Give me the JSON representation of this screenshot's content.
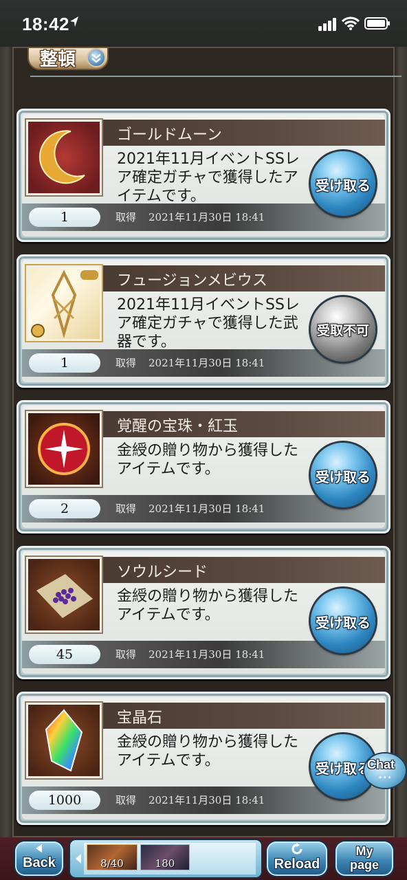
{
  "status_bar": {
    "time": "18:42"
  },
  "toolbar": {
    "sort_label": "整頓"
  },
  "items": [
    {
      "name": "ゴールドムーン",
      "description": "2021年11月イベントSSレア確定ガチャで獲得したアイテムです。",
      "quantity": "1",
      "acquired_label": "取得",
      "date": "2021年11月30日 18:41",
      "button": "受け取る",
      "button_state": "available"
    },
    {
      "name": "フュージョンメビウス",
      "description": "2021年11月イベントSSレア確定ガチャで獲得した武器です。",
      "quantity": "1",
      "acquired_label": "取得",
      "date": "2021年11月30日 18:41",
      "button": "受取不可",
      "button_state": "unavailable"
    },
    {
      "name": "覚醒の宝珠・紅玉",
      "description": "金綬の贈り物から獲得したアイテムです。",
      "quantity": "2",
      "acquired_label": "取得",
      "date": "2021年11月30日 18:41",
      "button": "受け取る",
      "button_state": "available"
    },
    {
      "name": "ソウルシード",
      "description": "金綬の贈り物から獲得したアイテムです。",
      "quantity": "45",
      "acquired_label": "取得",
      "date": "2021年11月30日 18:41",
      "button": "受け取る",
      "button_state": "available"
    },
    {
      "name": "宝晶石",
      "description": "金綬の贈り物から獲得したアイテムです。",
      "quantity": "1000",
      "acquired_label": "取得",
      "date": "2021年11月30日 18:41",
      "button": "受け取る",
      "button_state": "available"
    }
  ],
  "chat": {
    "label": "Chat"
  },
  "bottom_bar": {
    "back_label": "Back",
    "ap": "8/40",
    "bp": "180",
    "reload_label": "Reload",
    "mypage_label": "My page"
  }
}
